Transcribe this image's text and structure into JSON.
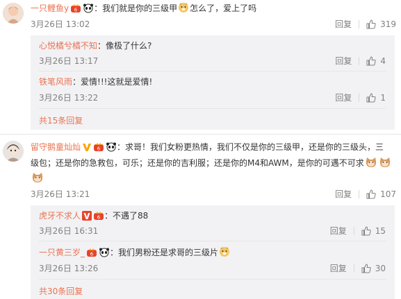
{
  "comments": [
    {
      "user": "一只鲤鱼y",
      "colon": "：",
      "text_a": "我们就是你的三级甲",
      "text_b": "怎么了，爱上了吗",
      "time": "3月26日 13:02",
      "reply_label": "回复",
      "likes": "319"
    },
    {
      "user": "留守鹅童灿灿",
      "colon": "：",
      "text_line1": "求哥！我们女粉更热情，我们不仅是你的三级甲，还是你的三级头，三",
      "text_line2": "级包；还是你的急救包，可乐；还是你的吉利服；还是你的M4和AWM，是你的可遇不可求",
      "time": "3月26日 13:21",
      "reply_label": "回复",
      "likes": "107"
    }
  ],
  "replies_1": [
    {
      "user": "心悦橘兮橘不知",
      "colon": "：",
      "text": "像极了什么?",
      "time": "3月26日 13:17",
      "reply_label": "回复",
      "likes": "4"
    },
    {
      "user": "铁笔风雨",
      "colon": "：",
      "text": "爱情!!!这就是爱情!",
      "time": "3月26日 13:22",
      "reply_label": "回复",
      "likes": "1"
    }
  ],
  "more_1": "共15条回复",
  "replies_2": [
    {
      "user": "虎牙不求人",
      "colon": "：",
      "text": "不遇了88",
      "time": "3月26日 16:31",
      "reply_label": "回复",
      "likes": "15"
    },
    {
      "user": "一只黄三岁_",
      "colon": "：",
      "text": "我们男粉还是求哥的三级片",
      "time": "3月26日 13:26",
      "reply_label": "回复",
      "likes": "30"
    }
  ],
  "more_2": "共30条回复",
  "colors": {
    "username": "#eb7350",
    "meta": "#808080",
    "reply_bg": "#f2f2f5",
    "vip_badge": "#f7a600",
    "member_badge": "#e8432a"
  },
  "icons": [
    "thumb-up-icon",
    "member-crown-icon",
    "panda-icon",
    "cat-emoji-icon",
    "verified-v-icon"
  ]
}
